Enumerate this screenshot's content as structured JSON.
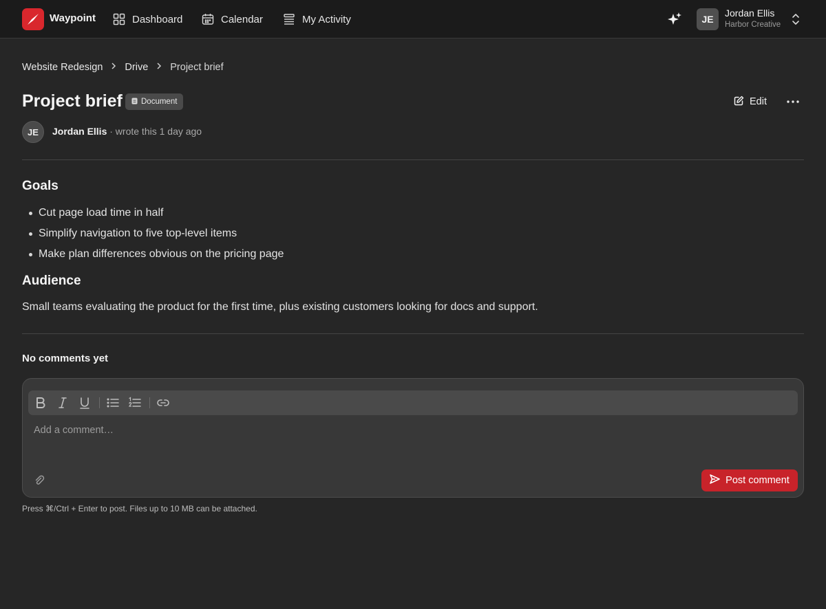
{
  "app": {
    "name": "Waypoint",
    "accent": "#d9272d"
  },
  "nav": {
    "dashboard": "Dashboard",
    "calendar": "Calendar",
    "activity": "My Activity"
  },
  "user": {
    "initials": "JE",
    "name": "Jordan Ellis",
    "org": "Harbor Creative"
  },
  "breadcrumb": [
    "Website Redesign",
    "Drive",
    "Project brief"
  ],
  "document": {
    "title": "Project brief",
    "type_badge": "Document",
    "edit_label": "Edit",
    "author_initials": "JE",
    "author": "Jordan Ellis",
    "byline": "· wrote this 1 day ago"
  },
  "content": {
    "goals_heading": "Goals",
    "goals": [
      "Cut page load time in half",
      "Simplify navigation to five top-level items",
      "Make plan differences obvious on the pricing page"
    ],
    "audience_heading": "Audience",
    "audience_text": "Small teams evaluating the product for the first time, plus existing customers looking for docs and support."
  },
  "comments": {
    "heading": "No comments yet",
    "placeholder": "Add a comment…",
    "post_label": "Post comment",
    "hint": "Press ⌘/Ctrl + Enter to post. Files up to 10 MB can be attached.",
    "post_color": "#c8232a"
  },
  "icons": [
    "logo-icon",
    "dashboard-icon",
    "calendar-icon",
    "activity-icon",
    "sparkle-icon",
    "chevron-updown-icon",
    "chevron-right-icon",
    "document-icon",
    "edit-icon",
    "more-icon",
    "bold-icon",
    "italic-icon",
    "underline-icon",
    "bullet-list-icon",
    "numbered-list-icon",
    "link-icon",
    "attach-icon",
    "send-icon"
  ]
}
